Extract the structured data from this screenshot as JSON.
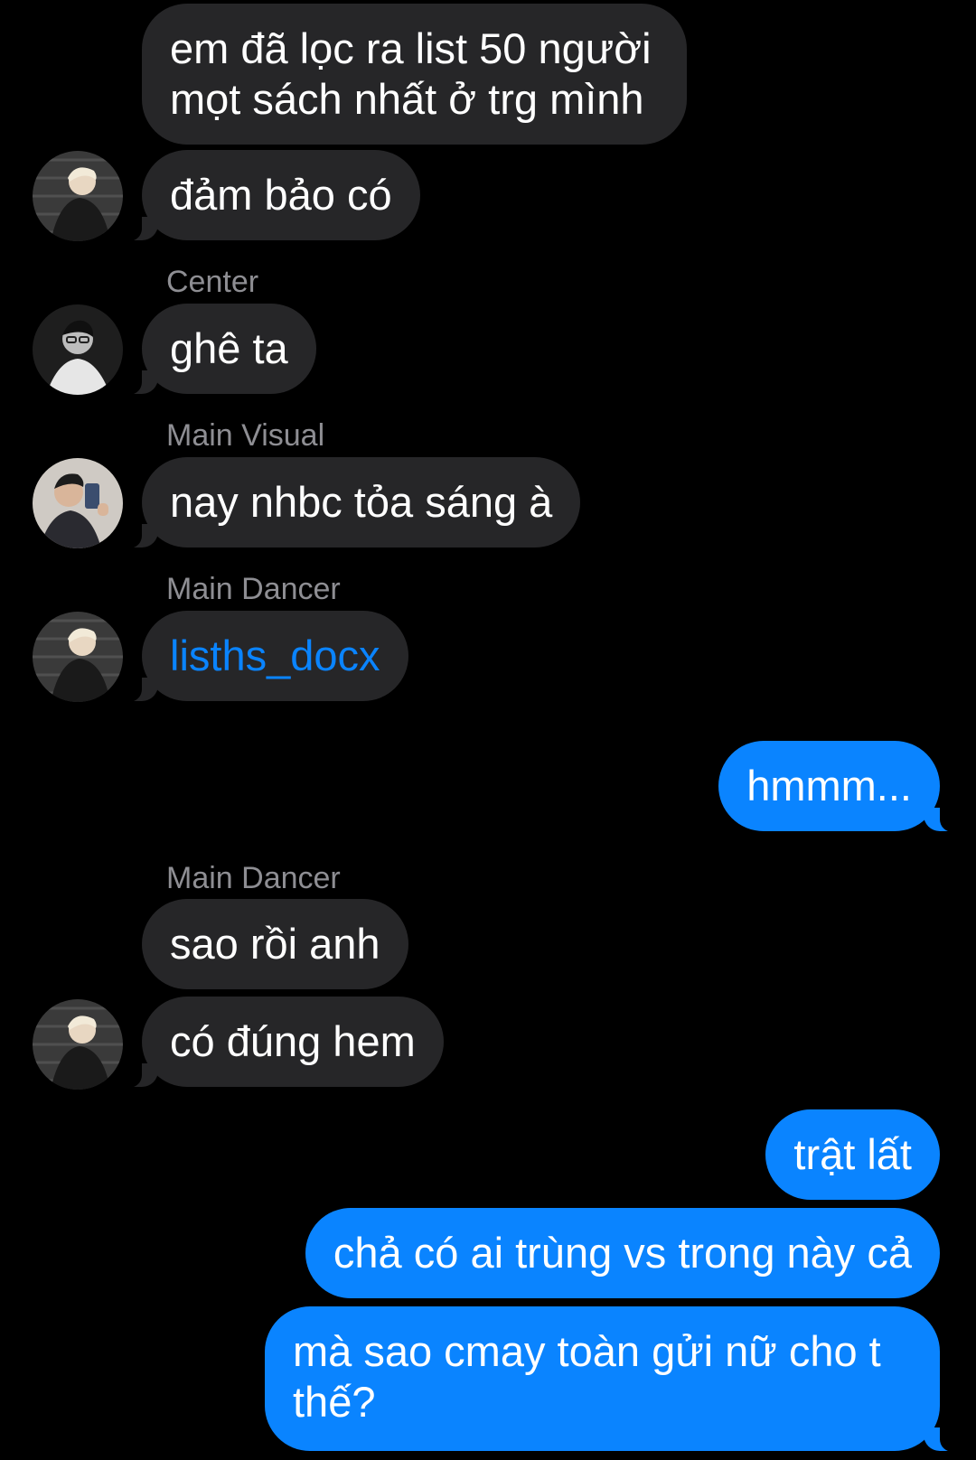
{
  "messages": {
    "m1_line1": "em đã lọc ra list 50 người",
    "m1_line2": "mọt sách nhất ở trg mình",
    "m2": "đảm bảo có",
    "m3_sender": "Center",
    "m3": "ghê ta",
    "m4_sender": "Main Visual",
    "m4": "nay nhbc tỏa sáng à",
    "m5_sender": "Main Dancer",
    "m5": "lisths_docx",
    "m6": "hmmm...",
    "m7_sender": "Main Dancer",
    "m7": "sao rồi anh",
    "m8": "có đúng hem",
    "m9": "trật lất",
    "m10": "chả có ai trùng vs trong này cả",
    "m11_line1": "mà sao cmay toàn gửi nữ cho t",
    "m11_line2": "thế?"
  },
  "colors": {
    "background": "#000000",
    "incoming_bubble": "#262628",
    "outgoing_bubble": "#0a84ff",
    "sender_label": "#8e8e93",
    "link": "#0a84ff"
  },
  "icons": {
    "avatar_main_dancer": "avatar-photo-blond-man",
    "avatar_center": "avatar-photo-man-glasses",
    "avatar_main_visual": "avatar-photo-man-selfie"
  }
}
